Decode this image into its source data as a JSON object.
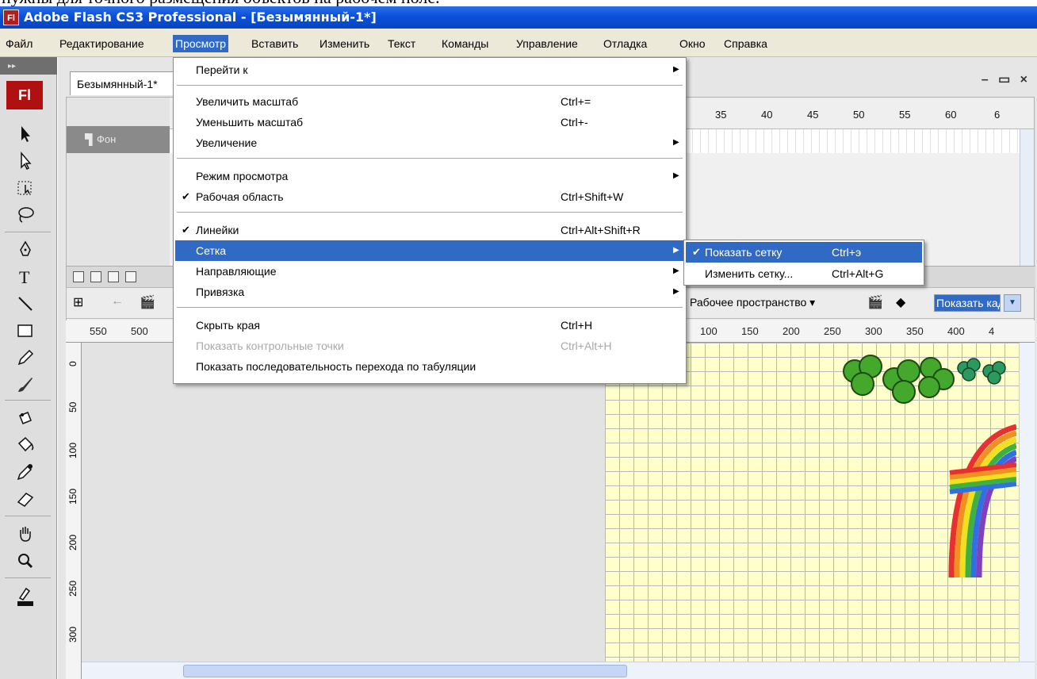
{
  "document_snippet": "нужны для точного размещения объектов на рабочем поле.",
  "window": {
    "app_icon": "Fl",
    "title": "Adobe Flash CS3 Professional - [Безымянный-1*]"
  },
  "menubar": {
    "items": [
      "Файл",
      "Редактирование",
      "Просмотр",
      "Вставить",
      "Изменить",
      "Текст",
      "Команды",
      "Управление",
      "Отладка",
      "Окно",
      "Справка"
    ],
    "active": "Просмотр"
  },
  "tools": {
    "logo": "Fl",
    "icons": [
      "selection-tool-icon",
      "subselection-tool-icon",
      "free-transform-tool-icon",
      "lasso-tool-icon",
      "pen-tool-icon",
      "text-tool-icon",
      "line-tool-icon",
      "rectangle-tool-icon",
      "pencil-tool-icon",
      "brush-tool-icon",
      "ink-bottle-tool-icon",
      "paint-bucket-tool-icon",
      "eyedropper-tool-icon",
      "eraser-tool-icon",
      "hand-tool-icon",
      "zoom-tool-icon",
      "stroke-color-icon"
    ]
  },
  "document": {
    "tab": "Безымянный-1*",
    "window_controls": "– ▭ ×"
  },
  "timeline": {
    "layer_name": "Фон",
    "frame_numbers": [
      "35",
      "40",
      "45",
      "50",
      "55",
      "60",
      "6"
    ]
  },
  "editbar": {
    "workspace": "Рабочее пространство ▾",
    "zoom_value": "Показать кадр"
  },
  "rulers": {
    "horizontal_left": [
      "550",
      "500"
    ],
    "horizontal_right": [
      "100",
      "150",
      "200",
      "250",
      "300",
      "350",
      "400",
      "4"
    ],
    "vertical": [
      "0",
      "50",
      "100",
      "150",
      "200",
      "250",
      "300"
    ]
  },
  "view_menu": {
    "items": [
      {
        "label": "Перейти к",
        "shortcut": "",
        "submenu": true,
        "checked": false,
        "disabled": false,
        "highlighted": false
      },
      {
        "separator": true
      },
      {
        "label": "Увеличить масштаб",
        "shortcut": "Ctrl+=",
        "submenu": false,
        "checked": false,
        "disabled": false,
        "highlighted": false
      },
      {
        "label": "Уменьшить масштаб",
        "shortcut": "Ctrl+-",
        "submenu": false,
        "checked": false,
        "disabled": false,
        "highlighted": false
      },
      {
        "label": "Увеличение",
        "shortcut": "",
        "submenu": true,
        "checked": false,
        "disabled": false,
        "highlighted": false
      },
      {
        "separator": true
      },
      {
        "label": "Режим просмотра",
        "shortcut": "",
        "submenu": true,
        "checked": false,
        "disabled": false,
        "highlighted": false
      },
      {
        "label": "Рабочая область",
        "shortcut": "Ctrl+Shift+W",
        "submenu": false,
        "checked": true,
        "disabled": false,
        "highlighted": false
      },
      {
        "separator": true
      },
      {
        "label": "Линейки",
        "shortcut": "Ctrl+Alt+Shift+R",
        "submenu": false,
        "checked": true,
        "disabled": false,
        "highlighted": false
      },
      {
        "label": "Сетка",
        "shortcut": "",
        "submenu": true,
        "checked": false,
        "disabled": false,
        "highlighted": true
      },
      {
        "label": "Направляющие",
        "shortcut": "",
        "submenu": true,
        "checked": false,
        "disabled": false,
        "highlighted": false
      },
      {
        "label": "Привязка",
        "shortcut": "",
        "submenu": true,
        "checked": false,
        "disabled": false,
        "highlighted": false
      },
      {
        "separator": true
      },
      {
        "label": "Скрыть края",
        "shortcut": "Ctrl+H",
        "submenu": false,
        "checked": false,
        "disabled": false,
        "highlighted": false
      },
      {
        "label": "Показать контрольные точки",
        "shortcut": "Ctrl+Alt+H",
        "submenu": false,
        "checked": false,
        "disabled": true,
        "highlighted": false
      },
      {
        "label": "Показать последовательность перехода по табуляции",
        "shortcut": "",
        "submenu": false,
        "checked": false,
        "disabled": false,
        "highlighted": false
      }
    ]
  },
  "grid_submenu": {
    "items": [
      {
        "label": "Показать сетку",
        "shortcut": "Ctrl+э",
        "checked": true,
        "highlighted": true
      },
      {
        "label": "Изменить сетку...",
        "shortcut": "Ctrl+Alt+G",
        "checked": false,
        "highlighted": false
      }
    ]
  },
  "colors": {
    "titlebar": "#0a50d8",
    "menu_highlight": "#316ac5",
    "stage": "#ffffcc",
    "grid": "#b7b7b7",
    "flash_red": "#b01010"
  }
}
